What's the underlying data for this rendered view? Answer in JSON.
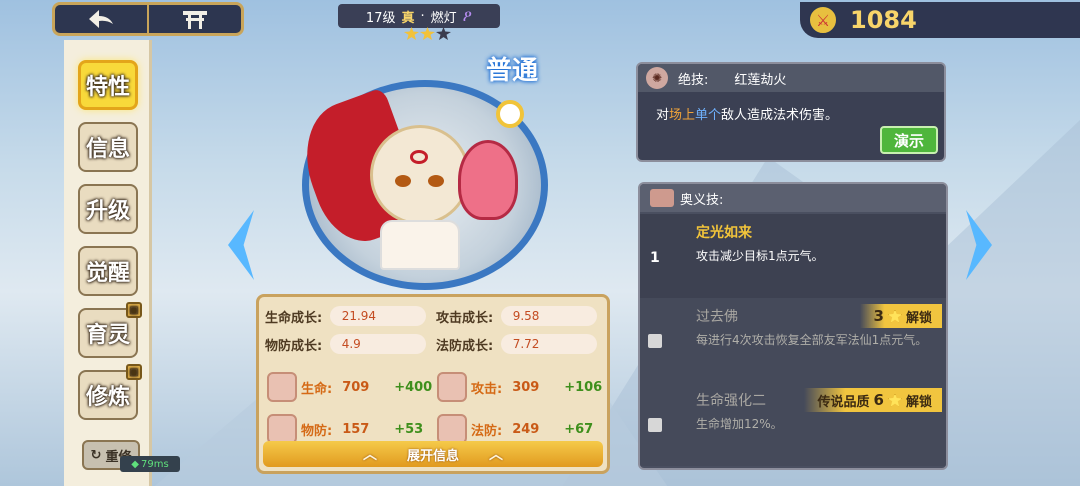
{
  "topbar": {
    "back_icon": "back-arrow-icon",
    "home_icon": "gate-icon",
    "hero_level": "17级",
    "hero_quality": "真",
    "hero_name": "燃灯",
    "hero_type_icon": "spirit-icon",
    "star_count": 2,
    "star_max": 3,
    "currency_icon": "sword-battle-icon",
    "currency_value": "1084"
  },
  "sidebar": {
    "items": [
      {
        "label": "特性",
        "active": true,
        "locked": false
      },
      {
        "label": "信息",
        "active": false,
        "locked": false
      },
      {
        "label": "升级",
        "active": false,
        "locked": false
      },
      {
        "label": "觉醒",
        "active": false,
        "locked": false
      },
      {
        "label": "育灵",
        "active": false,
        "locked": true
      },
      {
        "label": "修炼",
        "active": false,
        "locked": true
      }
    ],
    "reset_label": "重修",
    "ping": "79ms"
  },
  "portrait": {
    "rank_label": "普通"
  },
  "stats": {
    "growth": [
      {
        "label": "生命成长:",
        "value": "21.94"
      },
      {
        "label": "攻击成长:",
        "value": "9.58"
      },
      {
        "label": "物防成长:",
        "value": "4.9"
      },
      {
        "label": "法防成长:",
        "value": "7.72"
      }
    ],
    "attrs": [
      {
        "label": "生命:",
        "value": "709",
        "bonus": "+400",
        "icon": "heart-icon"
      },
      {
        "label": "攻击:",
        "value": "309",
        "bonus": "+106",
        "icon": "sword-icon"
      },
      {
        "label": "物防:",
        "value": "157",
        "bonus": "+53",
        "icon": "shield-icon"
      },
      {
        "label": "法防:",
        "value": "249",
        "bonus": "+67",
        "icon": "magic-shield-icon"
      }
    ],
    "expand_label": "展开信息"
  },
  "skill": {
    "title": "绝技:",
    "name": "红莲劫火",
    "desc_prefix": "对",
    "desc_highlight_1": "场上",
    "desc_highlight_2": "单个",
    "desc_suffix": "敌人造成法术伤害。",
    "demo_label": "演示"
  },
  "ultimate": {
    "title": "奥义技:",
    "rows": [
      {
        "num": "1",
        "name": "定光如来",
        "text": "攻击减少目标1点元气。",
        "unlocked": true
      },
      {
        "name": "过去佛",
        "text": "每进行4次攻击恢复全部友军法仙1点元气。",
        "req_prefix": "",
        "req_level": "3",
        "unlock_label": "解锁",
        "unlocked": false
      },
      {
        "name": "生命强化二",
        "text": "生命增加12%。",
        "req_prefix": "传说品质",
        "req_level": "6",
        "unlock_label": "解锁",
        "unlocked": false
      }
    ]
  },
  "colors": {
    "accent_gold": "#f8d56a",
    "panel_dark": "#3b4053",
    "nav_arrow": "#58b8ff",
    "bonus_green": "#3e8f1c"
  }
}
